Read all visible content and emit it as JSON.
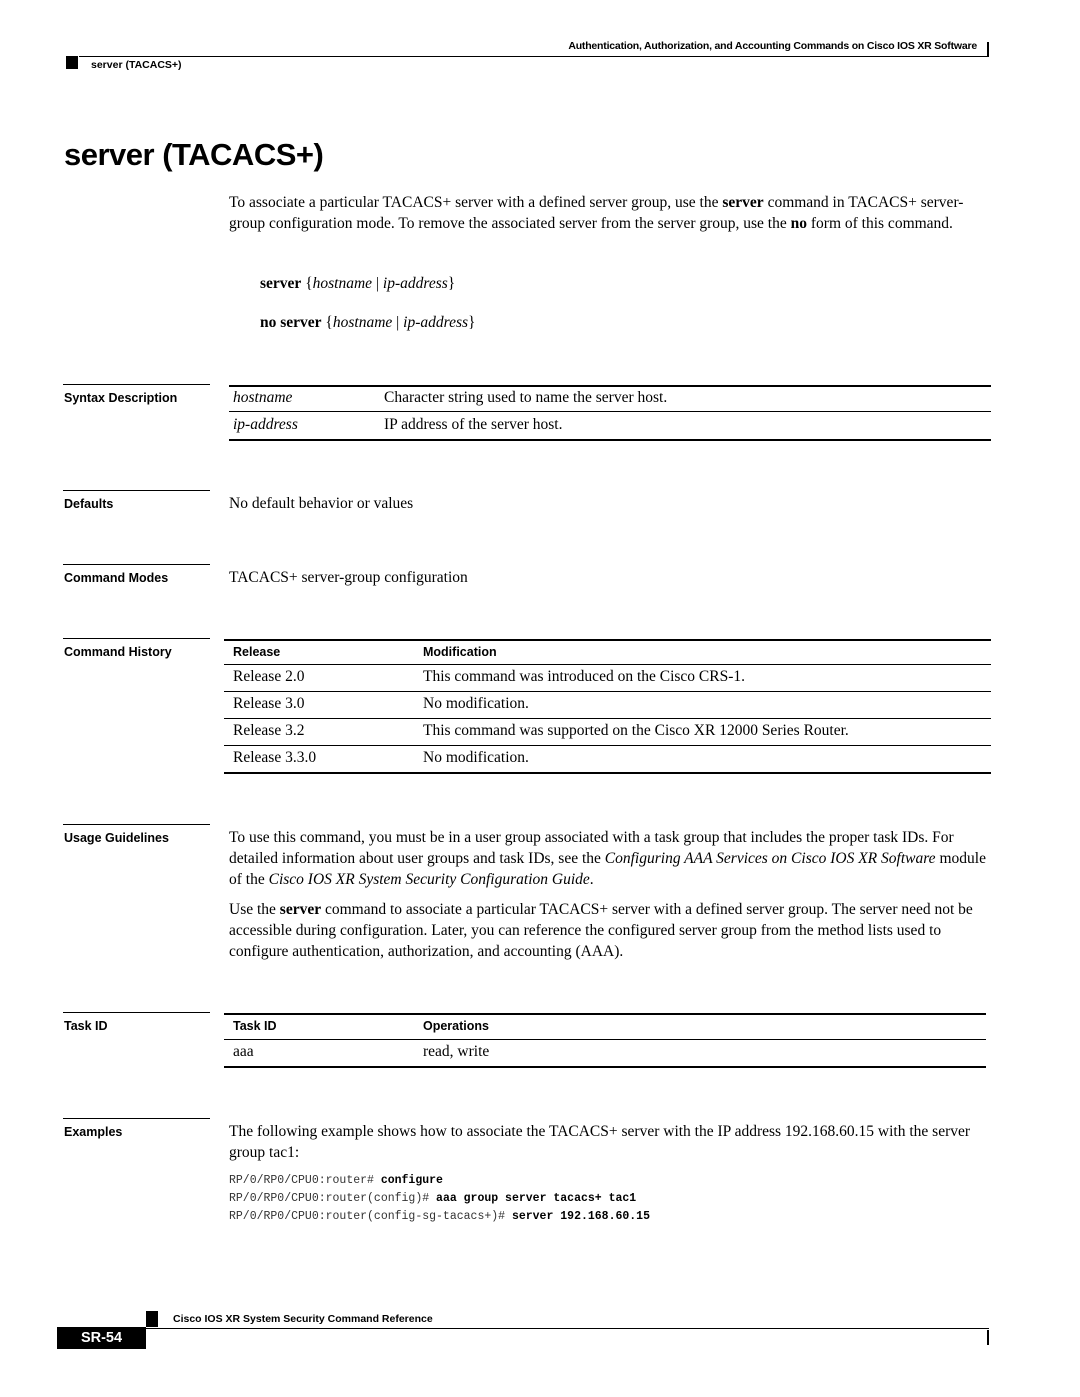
{
  "header": {
    "chapter_title": "Authentication, Authorization, and Accounting Commands on Cisco IOS XR Software",
    "running_head": "server (TACACS+)"
  },
  "page_title": "server (TACACS+)",
  "intro": {
    "p1_a": "To associate a particular TACACS+ server with a defined server group, use the ",
    "p1_b": "server",
    "p1_c": " command in TACACS+ server-group configuration mode. To remove the associated server from the server group, use the ",
    "p1_d": "no",
    "p1_e": " form of this command."
  },
  "syntax": [
    {
      "keyword": "server",
      "open": " {",
      "arg1": "hostname",
      "sep": " | ",
      "arg2": "ip-address",
      "close": "}"
    },
    {
      "keyword": "no server",
      "open": " {",
      "arg1": "hostname",
      "sep": " | ",
      "arg2": "ip-address",
      "close": "}"
    }
  ],
  "sections": {
    "syntax_description": "Syntax Description",
    "defaults": "Defaults",
    "command_modes": "Command Modes",
    "command_history": "Command History",
    "usage_guidelines": "Usage Guidelines",
    "task_id": "Task ID",
    "examples": "Examples"
  },
  "syntax_table": [
    {
      "term": "hostname",
      "desc": "Character string used to name the server host."
    },
    {
      "term": "ip-address",
      "desc": "IP address of the server host."
    }
  ],
  "defaults_text": "No default behavior or values",
  "command_modes_text": "TACACS+ server-group configuration",
  "history": {
    "headers": [
      "Release",
      "Modification"
    ],
    "rows": [
      [
        "Release 2.0",
        "This command was introduced on the Cisco CRS-1."
      ],
      [
        "Release 3.0",
        "No modification."
      ],
      [
        "Release 3.2",
        "This command was supported on the Cisco XR 12000 Series Router."
      ],
      [
        "Release 3.3.0",
        "No modification."
      ]
    ]
  },
  "usage": {
    "p1_a": "To use this command, you must be in a user group associated with a task group that includes the proper task IDs. For detailed information about user groups and task IDs, see the ",
    "p1_b": "Configuring AAA Services on Cisco IOS XR Software",
    "p1_c": " module of the ",
    "p1_d": "Cisco IOS XR System Security Configuration Guide",
    "p1_e": ".",
    "p2_a": "Use the ",
    "p2_b": "server",
    "p2_c": " command to associate a particular TACACS+ server with a defined server group. The server need not be accessible during configuration. Later, you can reference the configured server group from the method lists used to configure authentication, authorization, and accounting (AAA)."
  },
  "task_table": {
    "headers": [
      "Task ID",
      "Operations"
    ],
    "rows": [
      [
        "aaa",
        "read, write"
      ]
    ]
  },
  "examples": {
    "intro": "The following example shows how to associate the TACACS+ server with the IP address 192.168.60.15 with the server group tac1:",
    "lines": [
      {
        "prompt": "RP/0/RP0/CPU0:router# ",
        "cmd": "configure"
      },
      {
        "prompt": "RP/0/RP0/CPU0:router(config)# ",
        "cmd": "aaa group server tacacs+ tac1"
      },
      {
        "prompt": "RP/0/RP0/CPU0:router(config-sg-tacacs+)# ",
        "cmd": "server 192.168.60.15"
      }
    ]
  },
  "footer": {
    "book_title": "Cisco IOS XR System Security Command Reference",
    "page_number": "SR-54"
  }
}
